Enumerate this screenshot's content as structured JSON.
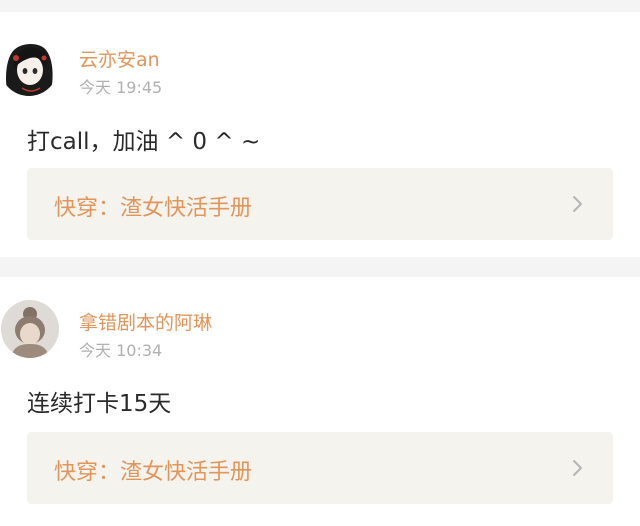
{
  "comments": [
    {
      "username": "云亦安an",
      "time": "今天 19:45",
      "content": "打call，加油 ^ 0 ^ ~",
      "book_title": "快穿：渣女快活手册",
      "avatar_icon": "avatar-anime-girl-icon"
    },
    {
      "username": "拿错剧本的阿琳",
      "time": "今天 10:34",
      "content": "连续打卡15天",
      "book_title": "快穿：渣女快活手册",
      "avatar_icon": "avatar-photo-icon"
    }
  ],
  "colors": {
    "accent": "#e0965a",
    "time": "#b0b0b0",
    "text": "#2a2a2a",
    "link_bg": "#f5f3ee",
    "page_bg": "#f4f4f4"
  }
}
